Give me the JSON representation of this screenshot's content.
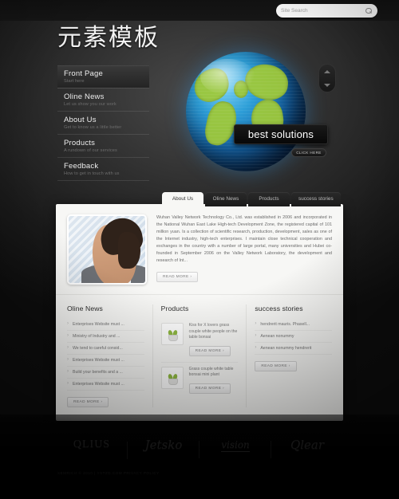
{
  "site": {
    "logo": "元素模板",
    "search_placeholder": "Site Search",
    "search_value": "",
    "search_icon": "search-icon"
  },
  "nav": {
    "items": [
      {
        "title": "Front Page",
        "sub": "Start here",
        "active": true
      },
      {
        "title": "Oline News",
        "sub": "Let us show you our work",
        "active": false
      },
      {
        "title": "About Us",
        "sub": "Get to know us a little better",
        "active": false
      },
      {
        "title": "Products",
        "sub": "A rundown of our services",
        "active": false
      },
      {
        "title": "Feedback",
        "sub": "How to get in touch with us",
        "active": false
      }
    ]
  },
  "banner": {
    "headline": "best solutions",
    "cta": "CLICK HERE",
    "up_icon": "chevron-up-icon",
    "down_icon": "chevron-down-icon"
  },
  "tabs": [
    {
      "label": "About Us",
      "active": true
    },
    {
      "label": "Oline News",
      "active": false
    },
    {
      "label": "Products",
      "active": false
    },
    {
      "label": "success stories",
      "active": false
    }
  ],
  "about": {
    "body": "Wuhan Valley Network Technology Co., Ltd. was established in 2006 and incorporated in the National Wuhan East Lake High-tech Development Zone, the registered capital of 101 million yuan. Is a collection of scientific research, production, development, sales as one of the Internet industry, high-tech enterprises.    I maintain close technical cooperation and exchanges in the country with a number of large portal, many universities and Hubei co-founded in September 2006 on the Valley Network Laboratory, the development and research of Int...",
    "read_more": "READ MORE ›",
    "photo_alt": "businessman-portrait"
  },
  "columns": {
    "news": {
      "title": "Oline News",
      "items": [
        "Enterprises Website must ...",
        "Ministry of Industry and ...",
        "We tend to careful consid...",
        "Enterprises Website must ...",
        "Build your benefits and a ...",
        "Enterprises Website must ..."
      ],
      "read_more": "READ MORE ›"
    },
    "products": {
      "title": "Products",
      "items": [
        {
          "text": "Kiss for X lovers grass couple white people on the table bonsai",
          "read_more": "READ MORE ›"
        },
        {
          "text": "Grass couple white table bonsai mini plant",
          "read_more": "READ MORE ›"
        }
      ]
    },
    "success": {
      "title": "success stories",
      "items": [
        "hendrerit mauris. Phasell...",
        "Aenean nonummy",
        "Aenean nonummy hendrerit"
      ],
      "read_more": "READ MORE ›"
    }
  },
  "brands": [
    {
      "name": "QLIUS"
    },
    {
      "name": "Jetsko"
    },
    {
      "name": "vision"
    },
    {
      "name": "Qlear"
    }
  ],
  "footer": {
    "copyright": "SEMRICH © 2010 | YSTZD.COM PRIVACY POLICY"
  },
  "colors": {
    "accent_green": "#9fc93a",
    "globe_blue": "#2e9fd8",
    "panel_bg": "#f7f7f5"
  }
}
